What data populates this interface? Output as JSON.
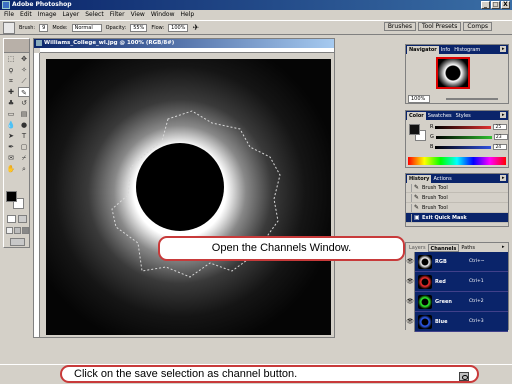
{
  "window": {
    "title": "Adobe Photoshop",
    "controls": [
      "_",
      "□",
      "X"
    ]
  },
  "menu": [
    "File",
    "Edit",
    "Image",
    "Layer",
    "Select",
    "Filter",
    "View",
    "Window",
    "Help"
  ],
  "options": {
    "brush_label": "Brush:",
    "brush_size": "9",
    "mode_label": "Mode:",
    "mode_value": "Normal",
    "opacity_label": "Opacity:",
    "opacity_value": "55%",
    "flow_label": "Flow:",
    "flow_value": "100%"
  },
  "palette_well": [
    "Brushes",
    "Tool Presets",
    "Comps"
  ],
  "document": {
    "title": "Williams_College_wl.jpg @ 100% (RGB/8#)"
  },
  "navigator": {
    "tabs": [
      "Navigator",
      "Info",
      "Histogram"
    ],
    "zoom": "100%"
  },
  "color_panel": {
    "tabs": [
      "Color",
      "Swatches",
      "Styles"
    ],
    "channels": [
      {
        "label": "R",
        "value": "25",
        "color": "#e03030"
      },
      {
        "label": "G",
        "value": "23",
        "color": "#30c030"
      },
      {
        "label": "B",
        "value": "24",
        "color": "#3050e0"
      }
    ]
  },
  "history": {
    "tabs": [
      "History",
      "Actions"
    ],
    "items": [
      "Brush Tool",
      "Brush Tool",
      "Brush Tool",
      "Exit Quick Mask"
    ]
  },
  "channels_panel": {
    "tabs": [
      "Layers",
      "Channels",
      "Paths"
    ],
    "rows": [
      {
        "name": "RGB",
        "shortcut": "Ctrl+~",
        "ring": "#ffffff"
      },
      {
        "name": "Red",
        "shortcut": "Ctrl+1",
        "ring": "#ff3030"
      },
      {
        "name": "Green",
        "shortcut": "Ctrl+2",
        "ring": "#30ff30"
      },
      {
        "name": "Blue",
        "shortcut": "Ctrl+3",
        "ring": "#3060ff"
      }
    ]
  },
  "callouts": {
    "channels": "Open the Channels Window.",
    "save_selection": "Click on the save selection as channel button."
  }
}
